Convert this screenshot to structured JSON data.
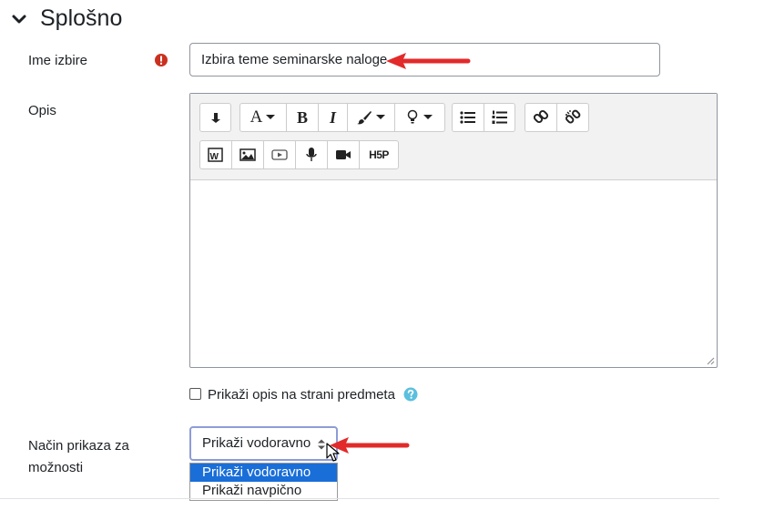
{
  "section": {
    "title": "Splošno",
    "icon": "chevron-down-icon"
  },
  "name_field": {
    "label": "Ime izbire",
    "value": "Izbira teme seminarske naloge",
    "required_icon": "exclamation-circle-icon"
  },
  "description": {
    "label": "Opis",
    "toolbar_icons": [
      "collapse-icon",
      "font-color-icon",
      "bold-icon",
      "italic-icon",
      "style-icon",
      "accessibility-icon",
      "unordered-list-icon",
      "ordered-list-icon",
      "link-icon",
      "unlink-icon",
      "word-import-icon",
      "image-icon",
      "media-icon",
      "record-audio-icon",
      "record-video-icon",
      "h5p-icon"
    ],
    "bold_label": "B",
    "italic_label": "I",
    "font_label": "A",
    "h5p_label": "H5P"
  },
  "show_description": {
    "label": "Prikaži opis na strani predmeta",
    "checked": false,
    "help_icon": "question-circle-icon"
  },
  "display_mode": {
    "label": "Način prikaza za možnosti",
    "selected": "Prikaži vodoravno",
    "options": [
      "Prikaži vodoravno",
      "Prikaži navpično"
    ],
    "selected_index": 0
  },
  "colors": {
    "accent": "#1a6ed8",
    "required": "#ca3120",
    "annotation_arrow": "#e22a2a",
    "help": "#5bc0de"
  }
}
